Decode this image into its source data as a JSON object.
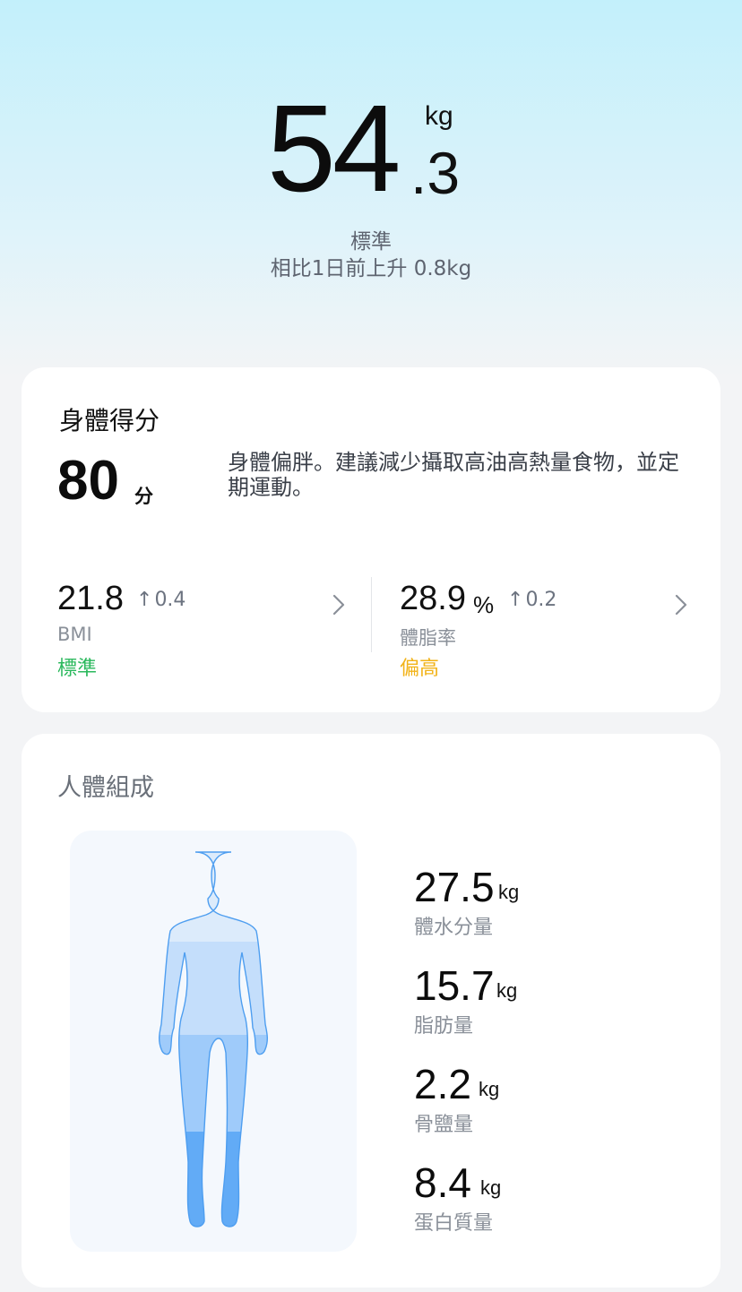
{
  "header": {
    "weight_int": "54",
    "weight_dec": ".3",
    "weight_unit": "kg",
    "status": "標準",
    "comparison": "相比1日前上升 0.8kg"
  },
  "score_card": {
    "title": "身體得分",
    "score": "80",
    "score_unit": "分",
    "description": "身體偏胖。建議減少攝取高油高熱量食物，並定期運動。",
    "bmi": {
      "value": "21.8",
      "change": "0.4",
      "label": "BMI",
      "status": "標準"
    },
    "body_fat": {
      "value": "28.9",
      "unit": "%",
      "change": "0.2",
      "label": "體脂率",
      "status": "偏高"
    }
  },
  "composition": {
    "title": "人體組成",
    "items": [
      {
        "value": "27.5",
        "unit": "kg",
        "label": "體水分量"
      },
      {
        "value": "15.7",
        "unit": "kg",
        "label": "脂肪量"
      },
      {
        "value": "2.2",
        "unit": "kg",
        "label": "骨鹽量"
      },
      {
        "value": "8.4",
        "unit": "kg",
        "label": "蛋白質量"
      }
    ]
  },
  "icons": {
    "arrow_up": "arrow-up-icon",
    "chevron": "chevron-right-icon",
    "body": "body-figure-icon"
  },
  "colors": {
    "status_green": "#2ab85c",
    "status_yellow": "#f2b318",
    "header_top": "#c3f0fb"
  }
}
